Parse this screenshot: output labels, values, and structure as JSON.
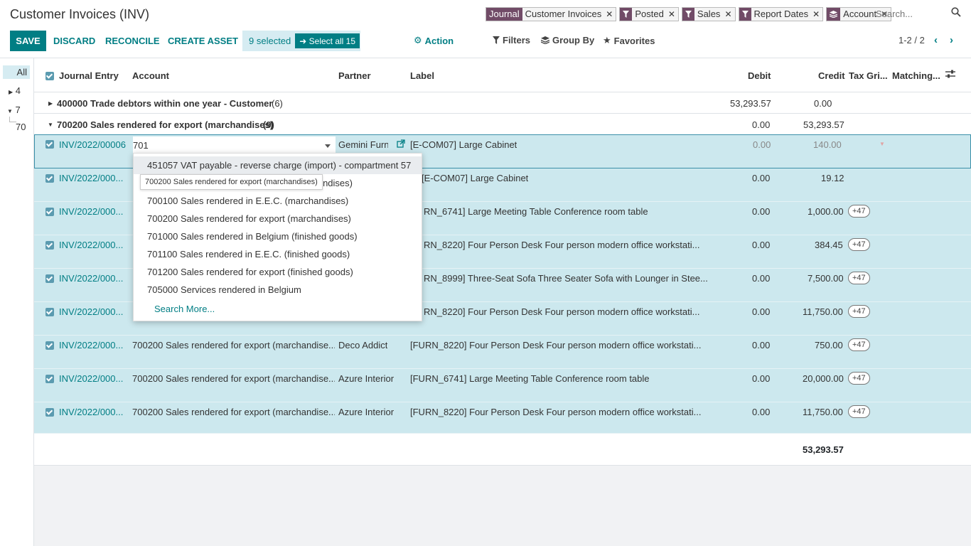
{
  "header": {
    "title": "Customer Invoices (INV)",
    "search_placeholder": "Search..."
  },
  "facets": [
    {
      "tag": "Journal",
      "value": "Customer Invoices"
    },
    {
      "value": "Posted"
    },
    {
      "value": "Sales"
    },
    {
      "value": "Report Dates"
    },
    {
      "value": "Account"
    }
  ],
  "toolbar": {
    "save": "SAVE",
    "discard": "DISCARD",
    "reconcile": "RECONCILE",
    "create_asset": "CREATE ASSET",
    "selected": "9 selected",
    "select_all": "Select all 15",
    "action": "Action",
    "filters": "Filters",
    "group_by": "Group By",
    "favorites": "Favorites",
    "pager": "1-2 / 2"
  },
  "left_panel": {
    "all": "All",
    "items": [
      "4",
      "7",
      "70"
    ]
  },
  "columns": {
    "journal_entry": "Journal Entry",
    "account": "Account",
    "partner": "Partner",
    "label": "Label",
    "debit": "Debit",
    "credit": "Credit",
    "tax_grids": "Tax Gri...",
    "matching": "Matching..."
  },
  "groups": [
    {
      "name": "400000 Trade debtors within one year - Customer",
      "count": "(6)",
      "debit": "53,293.57",
      "credit": "0.00"
    },
    {
      "name": "700200 Sales rendered for export (marchandises)",
      "count": "(9)",
      "debit": "0.00",
      "credit": "53,293.57"
    }
  ],
  "edit_row": {
    "journal_entry": "INV/2022/00006",
    "account_input": "701",
    "partner": "Gemini Furnit",
    "label": "[E-COM07] Large Cabinet",
    "debit": "0.00",
    "credit": "140.00"
  },
  "rows": [
    {
      "je": "INV/2022/000...",
      "account": "",
      "partner": "",
      "label": "[E-COM07] Large Cabinet",
      "label_prefix": "[E-",
      "debit": "0.00",
      "credit": "19.12",
      "badge": ""
    },
    {
      "je": "INV/2022/000...",
      "account": "",
      "partner": "",
      "label": "RN_6741] Large Meeting Table Conference room table",
      "debit": "0.00",
      "credit": "1,000.00",
      "badge": "+47"
    },
    {
      "je": "INV/2022/000...",
      "account": "",
      "partner": "",
      "label": "RN_8220] Four Person Desk Four person modern office workstati...",
      "debit": "0.00",
      "credit": "384.45",
      "badge": "+47"
    },
    {
      "je": "INV/2022/000...",
      "account": "",
      "partner": "",
      "label": "RN_8999] Three-Seat Sofa Three Seater Sofa with Lounger in Stee...",
      "debit": "0.00",
      "credit": "7,500.00",
      "badge": "+47"
    },
    {
      "je": "INV/2022/000...",
      "account": "",
      "partner": "",
      "label": "RN_8220] Four Person Desk Four person modern office workstati...",
      "debit": "0.00",
      "credit": "11,750.00",
      "badge": "+47"
    },
    {
      "je": "INV/2022/000...",
      "account": "700200 Sales rendered for export (marchandise...",
      "partner": "Deco Addict",
      "label": "[FURN_8220] Four Person Desk Four person modern office workstati...",
      "debit": "0.00",
      "credit": "750.00",
      "badge": "+47"
    },
    {
      "je": "INV/2022/000...",
      "account": "700200 Sales rendered for export (marchandise...",
      "partner": "Azure Interior",
      "label": "[FURN_6741] Large Meeting Table Conference room table",
      "debit": "0.00",
      "credit": "20,000.00",
      "badge": "+47"
    },
    {
      "je": "INV/2022/000...",
      "account": "700200 Sales rendered for export (marchandise...",
      "partner": "Azure Interior",
      "label": "[FURN_8220] Four Person Desk Four person modern office workstati...",
      "debit": "0.00",
      "credit": "11,750.00",
      "badge": "+47"
    }
  ],
  "total_credit": "53,293.57",
  "dropdown": {
    "items": [
      "451057 VAT payable - reverse charge (import) - compartment 57",
      "ndises)",
      "700100 Sales rendered in E.E.C. (marchandises)",
      "700200 Sales rendered for export (marchandises)",
      "701000 Sales rendered in Belgium (finished goods)",
      "701100 Sales rendered in E.E.C. (finished goods)",
      "701200 Sales rendered for export (finished goods)",
      "705000 Services rendered in Belgium"
    ],
    "search_more": "Search More...",
    "tooltip": "700200 Sales rendered for export (marchandises)"
  },
  "colors": {
    "accent": "#017e84",
    "brand": "#714B67",
    "selected_row": "#cce8ee"
  }
}
